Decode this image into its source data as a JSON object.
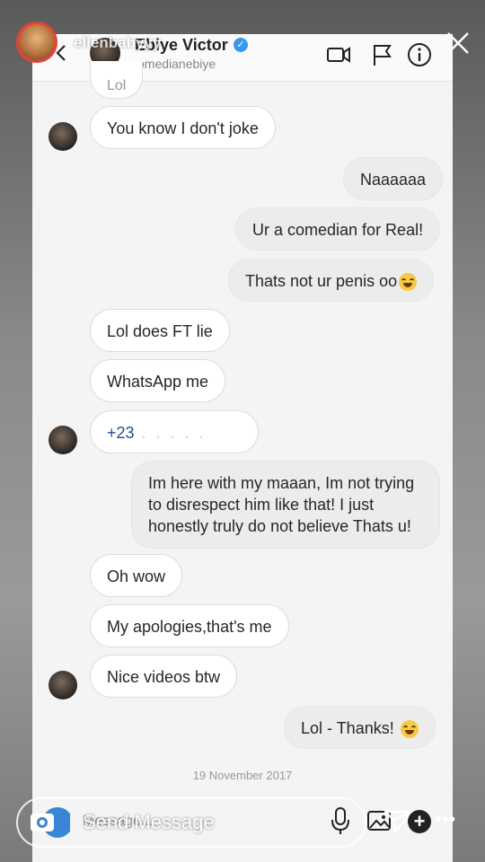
{
  "story": {
    "username": "ellenbabyyy",
    "send_placeholder": "Send Message"
  },
  "chat": {
    "name": "Ebiye Victor",
    "handle": "comedianebiye",
    "message_field_placeholder": "Message...",
    "date_separator": "19 November 2017",
    "partial_top_message": "Lol",
    "messages": [
      {
        "dir": "in",
        "text": "You know I don't joke"
      },
      {
        "dir": "out",
        "text": "Naaaaaa"
      },
      {
        "dir": "out",
        "text": "Ur a comedian for Real!"
      },
      {
        "dir": "out",
        "text": "Thats not ur penis oo"
      },
      {
        "dir": "in",
        "text": "Lol does FT lie"
      },
      {
        "dir": "in",
        "text": "WhatsApp me"
      },
      {
        "dir": "in",
        "text": "+23"
      },
      {
        "dir": "out",
        "text": "Im here with my maaan, Im not trying to disrespect him like that! I just honestly truly do not believe Thats u!"
      },
      {
        "dir": "in",
        "text": "Oh wow"
      },
      {
        "dir": "in",
        "text": "My apologies,that's me"
      },
      {
        "dir": "in",
        "text": "Nice videos btw"
      },
      {
        "dir": "out",
        "text": "Lol - Thanks!"
      }
    ]
  },
  "icons": {
    "back": "chevron-left-icon",
    "video": "video-camera-icon",
    "flag": "flag-icon",
    "info": "info-icon",
    "close": "close-icon",
    "camera": "camera-icon",
    "mic": "microphone-icon",
    "gallery": "gallery-icon",
    "plus": "plus-icon",
    "send": "send-icon",
    "more": "more-icon"
  },
  "colors": {
    "verified": "#3897f0",
    "story_ring": "#e0443a",
    "incoming_bubble": "#ffffff",
    "outgoing_bubble": "#ececec"
  }
}
